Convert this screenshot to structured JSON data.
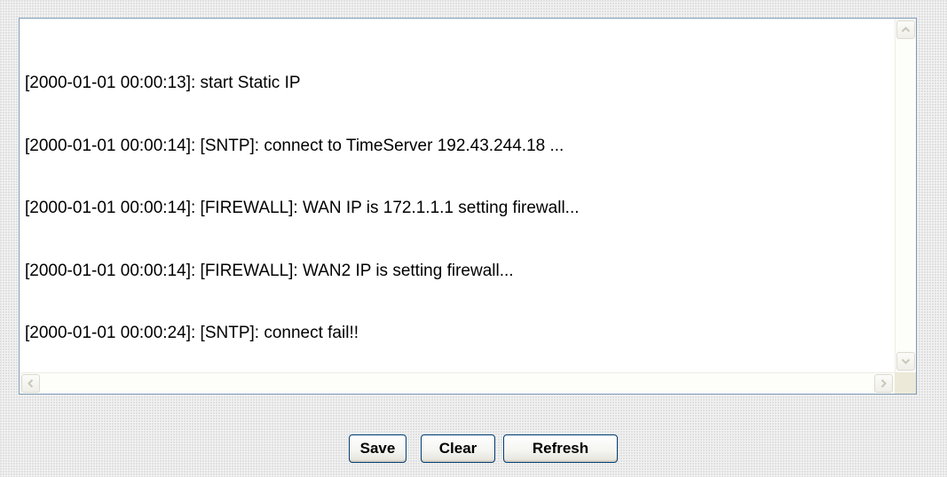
{
  "log": {
    "lines": [
      "[2000-01-01 00:00:13]: start Static IP",
      "[2000-01-01 00:00:14]: [SNTP]: connect to TimeServer 192.43.244.18 ...",
      "[2000-01-01 00:00:14]: [FIREWALL]: WAN IP is 172.1.1.1 setting firewall...",
      "[2000-01-01 00:00:14]: [FIREWALL]: WAN2 IP is setting firewall...",
      "[2000-01-01 00:00:24]: [SNTP]: connect fail!!"
    ]
  },
  "scrollbars": {
    "icons": [
      "arrow-up-icon",
      "arrow-down-icon",
      "arrow-left-icon",
      "arrow-right-icon"
    ],
    "state": "disabled"
  },
  "buttons": {
    "save_label": "Save",
    "clear_label": "Clear",
    "refresh_label": "Refresh"
  },
  "colors": {
    "border": "#7f9db9",
    "button_border": "#003c74",
    "background": "#f2f2f2"
  }
}
